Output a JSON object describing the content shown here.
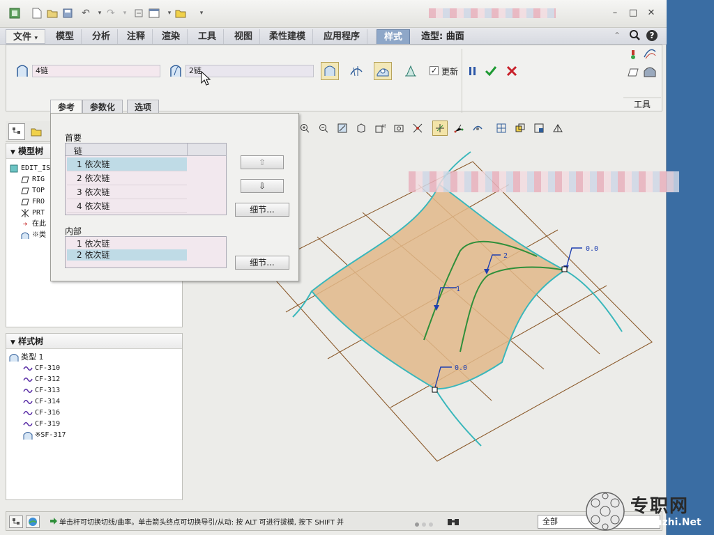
{
  "titlebar": {
    "min": "–",
    "max": "□",
    "close": "✕"
  },
  "tabs": {
    "file": "文件",
    "file_arrow": "▾",
    "items": [
      "模型",
      "分析",
      "注释",
      "渲染",
      "工具",
      "视图",
      "柔性建模",
      "应用程序",
      "样式"
    ],
    "mode_title": "造型: 曲面"
  },
  "ribbon": {
    "chain1_value": "4链",
    "chain2_value": "2链",
    "update_label": "更新",
    "tools_label": "工具",
    "subtabs": [
      "参考",
      "参数化",
      "选项"
    ]
  },
  "refpanel": {
    "primary_label": "首要",
    "column_header": "链",
    "primary_items": [
      "1 依次链",
      "2 依次链",
      "3 依次链",
      "4 依次链"
    ],
    "internal_label": "内部",
    "internal_items": [
      "1 依次链",
      "2 依次链"
    ],
    "detail_button": "细节...",
    "up_icon": "⇧",
    "down_icon": "⇩"
  },
  "modeltree": {
    "header": "模型树",
    "items": [
      "EDIT_IS",
      "RIG",
      "TOP",
      "FRO",
      "PRT",
      "在此",
      "※类"
    ]
  },
  "styletree": {
    "header": "样式树",
    "root": "类型 1",
    "items": [
      "CF-310",
      "CF-312",
      "CF-313",
      "CF-314",
      "CF-316",
      "CF-319"
    ],
    "surface": "※SF-317"
  },
  "viewport": {
    "labels": {
      "c1": "1",
      "c2": "2",
      "v1": "0.0",
      "v2": "0.0"
    }
  },
  "status": {
    "message": "单击杆可切换切线/曲率。单击箭头终点可切换导引/从动: 按 ALT 可进行拔模, 按下 SHIFT 并",
    "filter": "全部"
  },
  "watermark": {
    "cn": "专职网",
    "en": "Zhuanzhi.Net"
  },
  "colors": {
    "accent_tab": "#8ea7c8",
    "surface": "#e2b98a",
    "curve_green": "#2f8f3a",
    "edge_cyan": "#3ab7bb",
    "grid_brown": "#8b5a2b",
    "arrow_blue": "#1f3fb0"
  }
}
